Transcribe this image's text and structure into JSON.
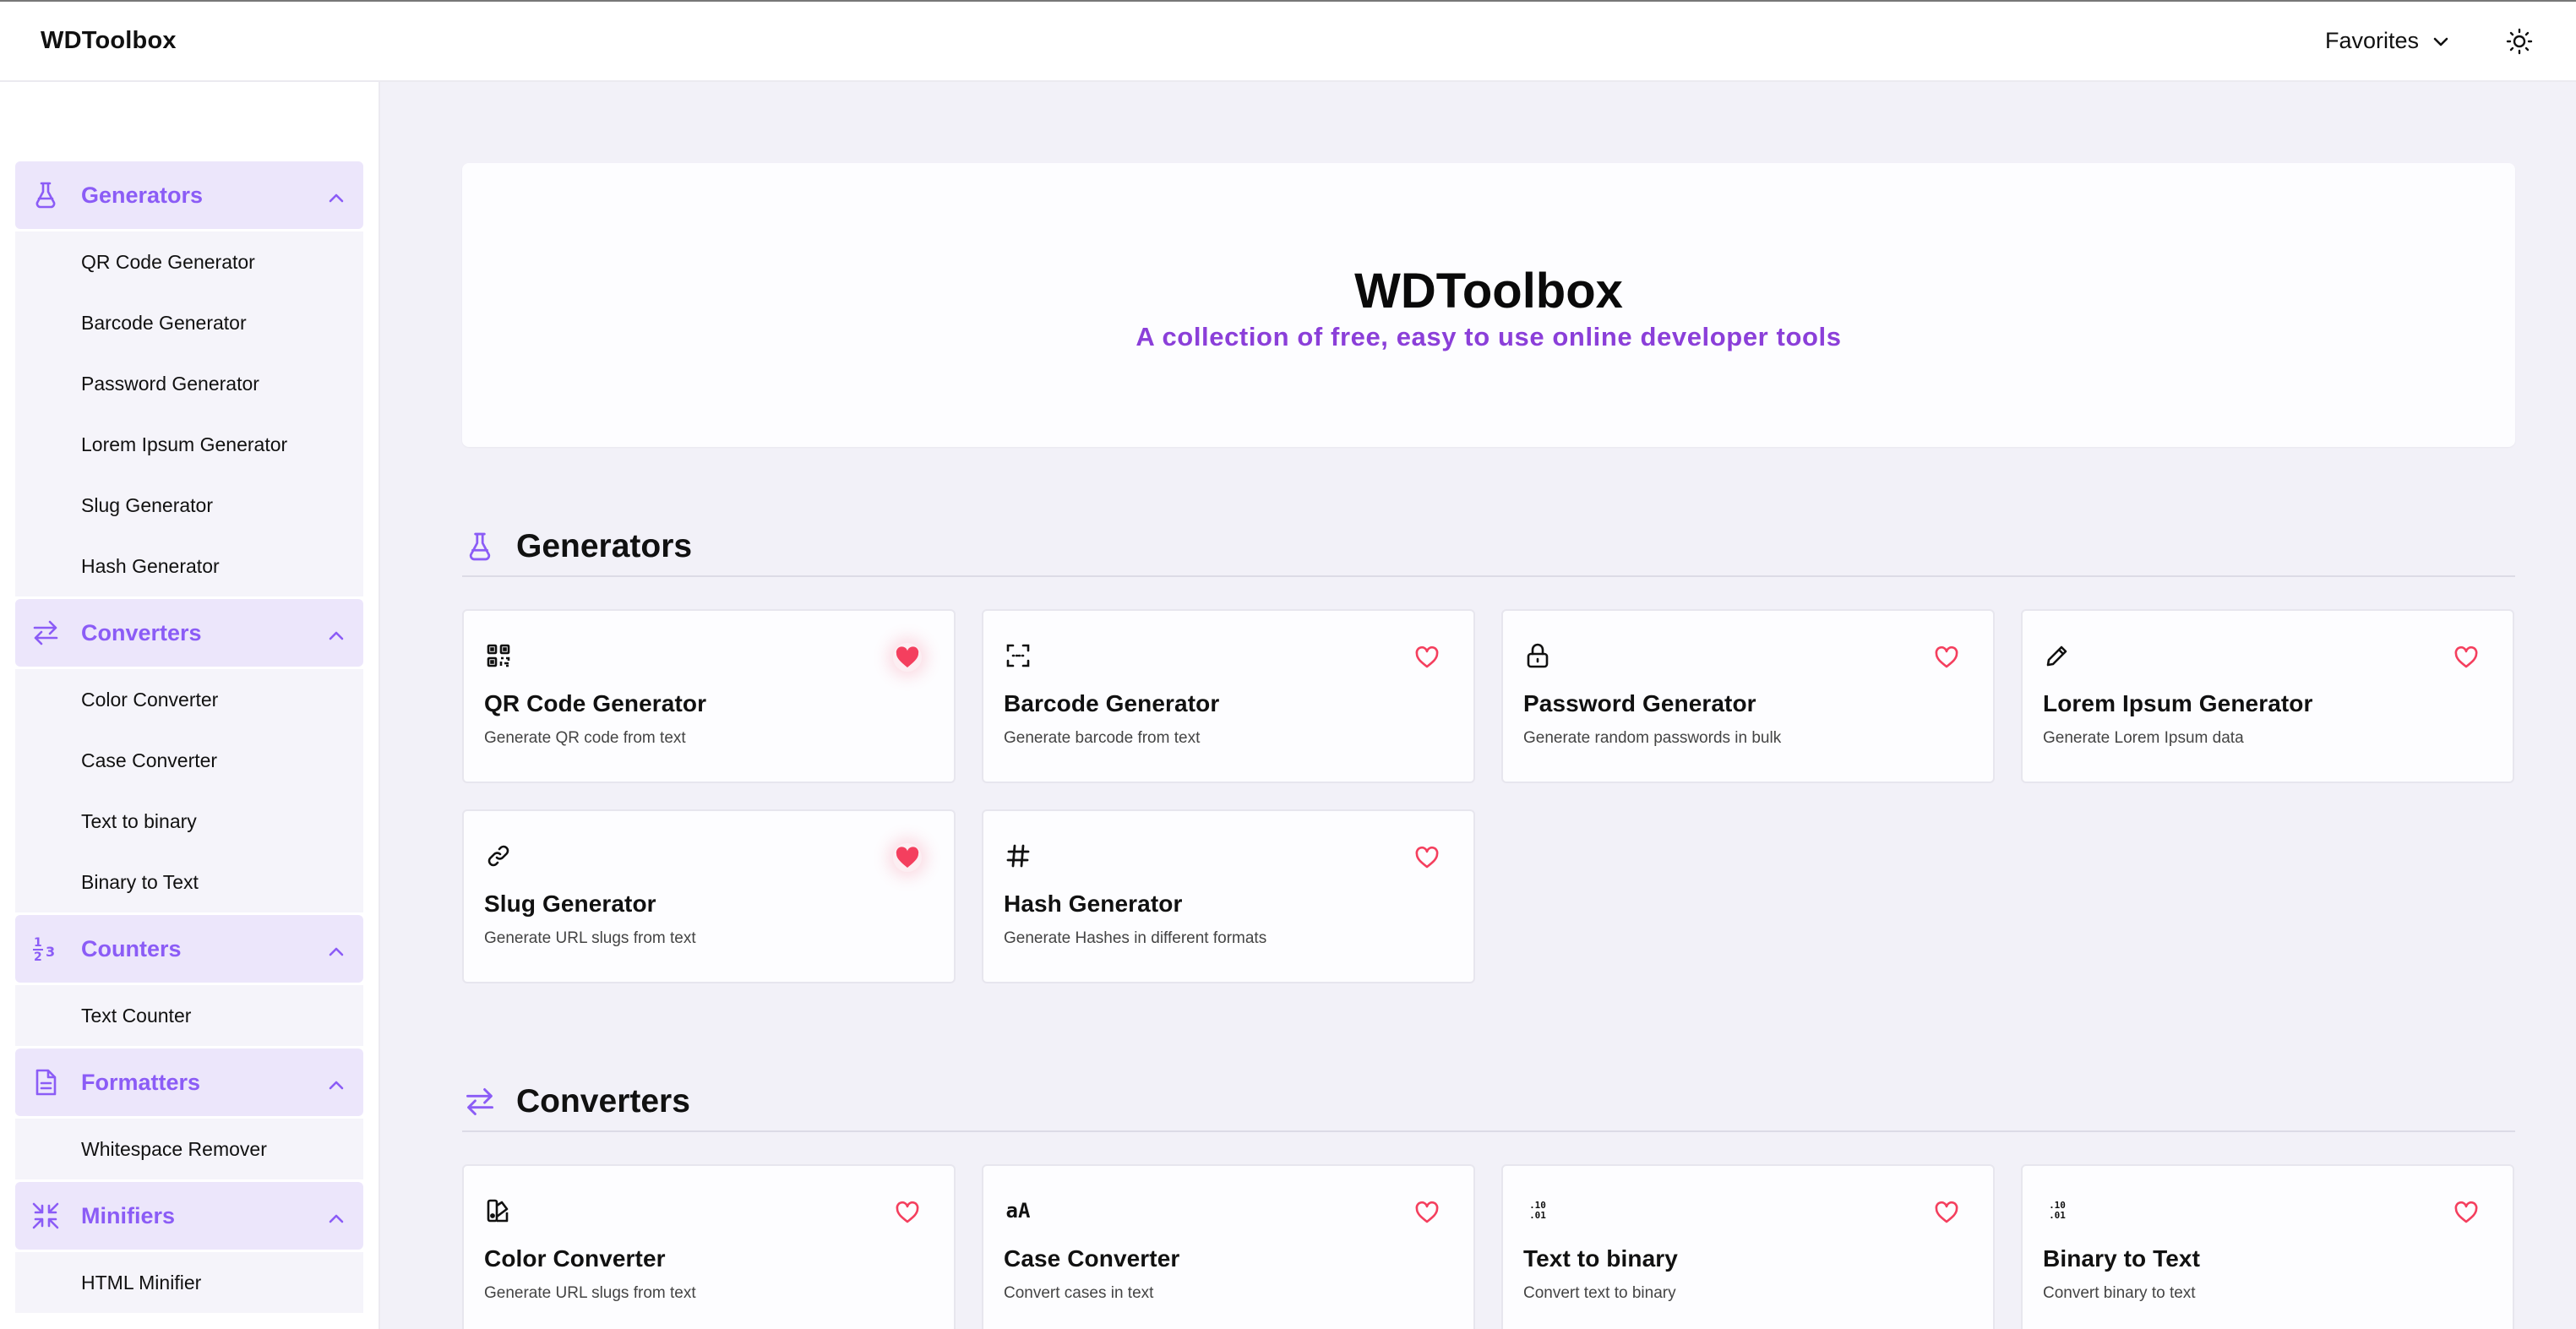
{
  "header": {
    "brand": "WDToolbox",
    "favorites_label": "Favorites"
  },
  "colors": {
    "accent": "#8b5cf6",
    "accent_bg": "#ece6fb",
    "heart": "#f43f5e",
    "subtitle": "#8b3fd9"
  },
  "sidebar": {
    "groups": [
      {
        "label": "Generators",
        "icon": "flask-icon",
        "items": [
          "QR Code Generator",
          "Barcode Generator",
          "Password Generator",
          "Lorem Ipsum Generator",
          "Slug Generator",
          "Hash Generator"
        ]
      },
      {
        "label": "Converters",
        "icon": "arrows-swap-icon",
        "items": [
          "Color Converter",
          "Case Converter",
          "Text to binary",
          "Binary to Text"
        ]
      },
      {
        "label": "Counters",
        "icon": "numbers-icon",
        "items": [
          "Text Counter"
        ]
      },
      {
        "label": "Formatters",
        "icon": "document-icon",
        "items": [
          "Whitespace Remover"
        ]
      },
      {
        "label": "Minifiers",
        "icon": "compress-icon",
        "items": [
          "HTML Minifier"
        ]
      }
    ]
  },
  "hero": {
    "title": "WDToolbox",
    "subtitle": "A collection of free, easy to use online developer tools"
  },
  "sections": [
    {
      "title": "Generators",
      "icon": "flask-icon",
      "cards": [
        {
          "title": "QR Code Generator",
          "desc": "Generate QR code from text",
          "icon": "qr-code-icon",
          "favorite": true
        },
        {
          "title": "Barcode Generator",
          "desc": "Generate barcode from text",
          "icon": "barcode-icon",
          "favorite": false
        },
        {
          "title": "Password Generator",
          "desc": "Generate random passwords in bulk",
          "icon": "lock-icon",
          "favorite": false
        },
        {
          "title": "Lorem Ipsum Generator",
          "desc": "Generate Lorem Ipsum data",
          "icon": "pencil-icon",
          "favorite": false
        },
        {
          "title": "Slug Generator",
          "desc": "Generate URL slugs from text",
          "icon": "link-icon",
          "favorite": true
        },
        {
          "title": "Hash Generator",
          "desc": "Generate Hashes in different formats",
          "icon": "hash-icon",
          "favorite": false
        }
      ]
    },
    {
      "title": "Converters",
      "icon": "arrows-swap-icon",
      "cards": [
        {
          "title": "Color Converter",
          "desc": "Generate URL slugs from text",
          "icon": "palette-icon",
          "favorite": false
        },
        {
          "title": "Case Converter",
          "desc": "Convert cases in text",
          "icon": "case-icon",
          "icon_text": "aA",
          "favorite": false
        },
        {
          "title": "Text to binary",
          "desc": "Convert text to binary",
          "icon": "binary-icon",
          "icon_text": ".10\n.01",
          "favorite": false
        },
        {
          "title": "Binary to Text",
          "desc": "Convert binary to text",
          "icon": "binary-icon",
          "icon_text": ".10\n.01",
          "favorite": false
        }
      ]
    }
  ]
}
